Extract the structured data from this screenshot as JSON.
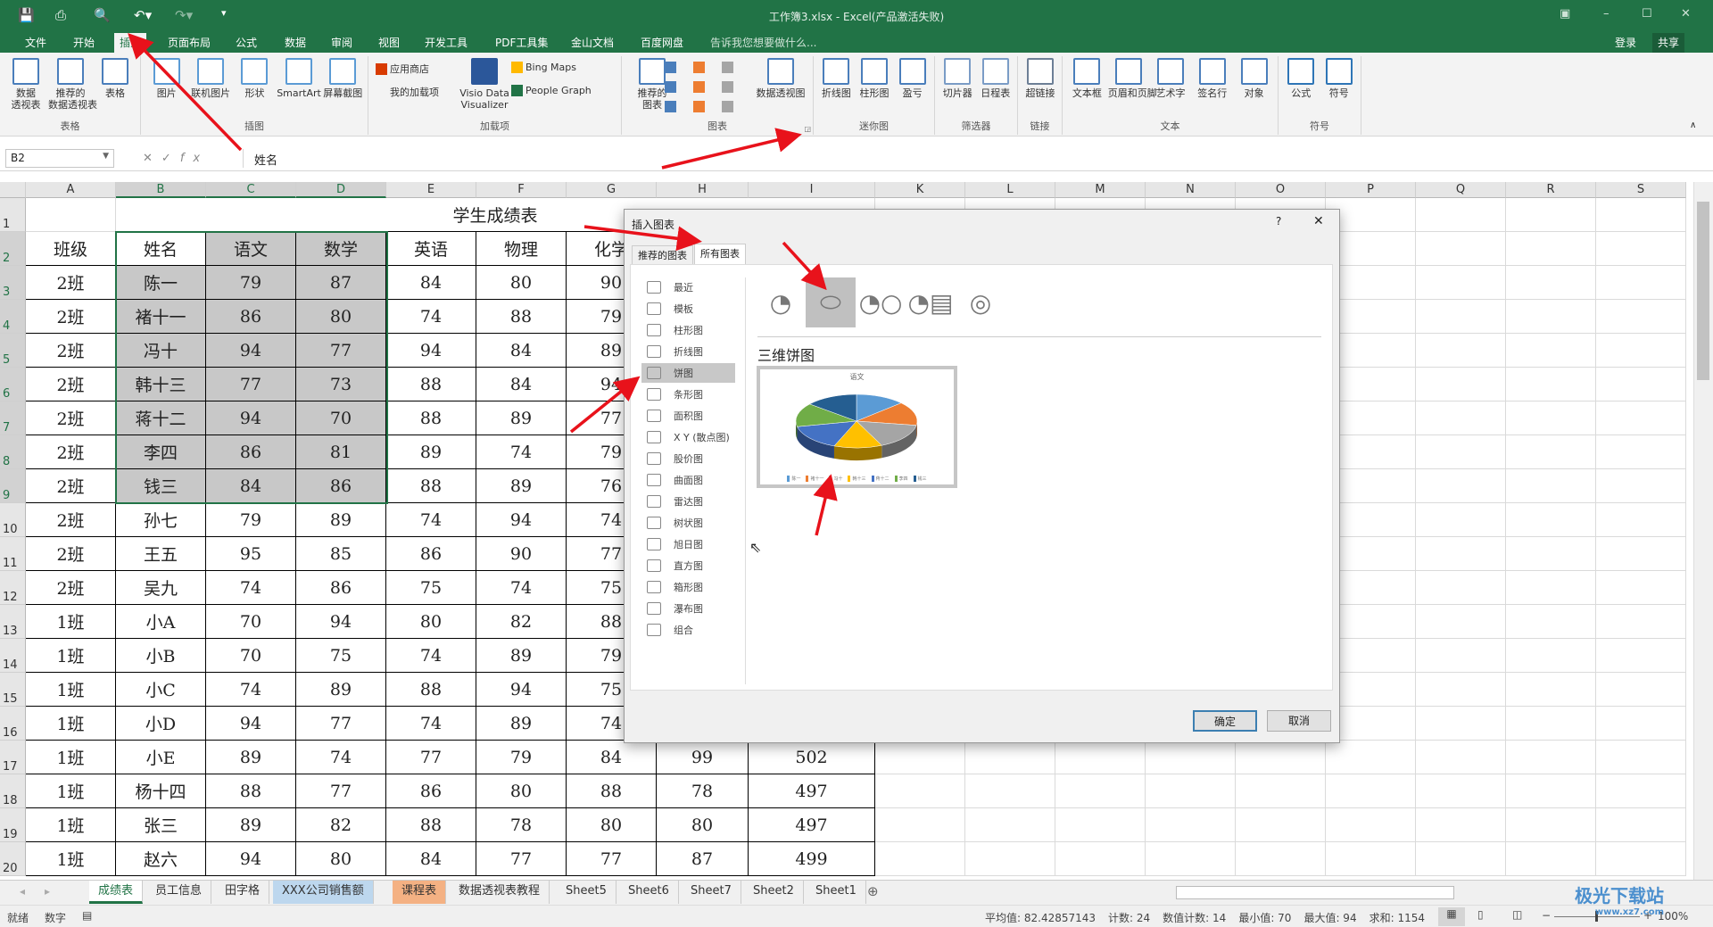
{
  "window": {
    "title": "工作簿3.xlsx - Excel(产品激活失败)",
    "controls": [
      "ribbon-display",
      "minimize",
      "maximize",
      "close"
    ]
  },
  "menu": {
    "tabs": [
      "文件",
      "开始",
      "插入",
      "页面布局",
      "公式",
      "数据",
      "审阅",
      "视图",
      "开发工具",
      "PDF工具集",
      "金山文档",
      "百度网盘"
    ],
    "active": "插入",
    "tell_me": "告诉我您想要做什么...",
    "login": "登录",
    "share": "共享"
  },
  "ribbon": {
    "groups": [
      {
        "label": "表格",
        "buttons": [
          "数据\n透视表",
          "推荐的\n数据透视表",
          "表格"
        ]
      },
      {
        "label": "插图",
        "buttons": [
          "图片",
          "联机图片",
          "形状",
          "SmartArt",
          "屏幕截图"
        ]
      },
      {
        "label": "加载项",
        "buttons": [
          "应用商店",
          "我的加载项",
          "Visio Data\nVisualizer",
          "Bing Maps",
          "People Graph"
        ]
      },
      {
        "label": "图表",
        "buttons": [
          "推荐的\n图表",
          "数据透视图"
        ]
      },
      {
        "label": "迷你图",
        "buttons": [
          "折线图",
          "柱形图",
          "盈亏"
        ]
      },
      {
        "label": "筛选器",
        "buttons": [
          "切片器",
          "日程表"
        ]
      },
      {
        "label": "链接",
        "buttons": [
          "超链接"
        ]
      },
      {
        "label": "文本",
        "buttons": [
          "文本框",
          "页眉和页脚",
          "艺术字",
          "签名行",
          "对象"
        ]
      },
      {
        "label": "符号",
        "buttons": [
          "公式",
          "符号"
        ]
      }
    ]
  },
  "formula_bar": {
    "name_box": "B2",
    "fx": "fx",
    "value": "姓名"
  },
  "sheet": {
    "columns": [
      "A",
      "B",
      "C",
      "D",
      "E",
      "F",
      "G",
      "H",
      "I",
      "K",
      "L",
      "M",
      "N",
      "O",
      "P",
      "Q",
      "R",
      "S"
    ],
    "title": "学生成绩表",
    "header": [
      "班级",
      "姓名",
      "语文",
      "数学",
      "英语",
      "物理",
      "化学",
      "",
      ""
    ],
    "rows": [
      [
        "2班",
        "陈一",
        "79",
        "87",
        "84",
        "80",
        "90",
        "",
        ""
      ],
      [
        "2班",
        "褚十一",
        "86",
        "80",
        "74",
        "88",
        "79",
        "",
        ""
      ],
      [
        "2班",
        "冯十",
        "94",
        "77",
        "94",
        "84",
        "89",
        "",
        ""
      ],
      [
        "2班",
        "韩十三",
        "77",
        "73",
        "88",
        "84",
        "94",
        "",
        ""
      ],
      [
        "2班",
        "蒋十二",
        "94",
        "70",
        "88",
        "89",
        "77",
        "",
        ""
      ],
      [
        "2班",
        "李四",
        "86",
        "81",
        "89",
        "74",
        "79",
        "",
        ""
      ],
      [
        "2班",
        "钱三",
        "84",
        "86",
        "88",
        "89",
        "76",
        "",
        ""
      ],
      [
        "2班",
        "孙七",
        "79",
        "89",
        "74",
        "94",
        "74",
        "",
        ""
      ],
      [
        "2班",
        "王五",
        "95",
        "85",
        "86",
        "90",
        "77",
        "",
        ""
      ],
      [
        "2班",
        "吴九",
        "74",
        "86",
        "75",
        "74",
        "75",
        "",
        ""
      ],
      [
        "1班",
        "小A",
        "70",
        "94",
        "80",
        "82",
        "88",
        "",
        ""
      ],
      [
        "1班",
        "小B",
        "70",
        "75",
        "74",
        "89",
        "79",
        "",
        ""
      ],
      [
        "1班",
        "小C",
        "74",
        "89",
        "88",
        "94",
        "75",
        "",
        ""
      ],
      [
        "1班",
        "小D",
        "94",
        "77",
        "74",
        "89",
        "74",
        "",
        ""
      ],
      [
        "1班",
        "小E",
        "89",
        "74",
        "77",
        "79",
        "84",
        "99",
        "502"
      ],
      [
        "1班",
        "杨十四",
        "88",
        "77",
        "86",
        "80",
        "88",
        "78",
        "497"
      ],
      [
        "1班",
        "张三",
        "89",
        "82",
        "88",
        "78",
        "80",
        "80",
        "497"
      ],
      [
        "1班",
        "赵六",
        "94",
        "80",
        "84",
        "77",
        "77",
        "87",
        "499"
      ]
    ]
  },
  "sheet_tabs": [
    {
      "label": "成绩表",
      "active": true
    },
    {
      "label": "员工信息"
    },
    {
      "label": "田字格"
    },
    {
      "label": "XXX公司销售额",
      "color": "#bdd7ee"
    },
    {
      "label": "课程表",
      "color": "#f4b183"
    },
    {
      "label": "数据透视表教程"
    },
    {
      "label": "Sheet5"
    },
    {
      "label": "Sheet6"
    },
    {
      "label": "Sheet7"
    },
    {
      "label": "Sheet2"
    },
    {
      "label": "Sheet1"
    }
  ],
  "status": {
    "ready": "就绪",
    "mode": "数字",
    "average": "平均值: 82.42857143",
    "count": "计数: 24",
    "numeric_count": "数值计数: 14",
    "min": "最小值: 70",
    "max": "最大值: 94",
    "sum": "求和: 1154",
    "zoom": "100%"
  },
  "dialog": {
    "title": "插入图表",
    "help": "?",
    "close": "✕",
    "tabs": [
      "推荐的图表",
      "所有图表"
    ],
    "active_tab": "所有图表",
    "categories": [
      "最近",
      "模板",
      "柱形图",
      "折线图",
      "饼图",
      "条形图",
      "面积图",
      "X Y (散点图)",
      "股价图",
      "曲面图",
      "雷达图",
      "树状图",
      "旭日图",
      "直方图",
      "箱形图",
      "瀑布图",
      "组合"
    ],
    "selected_category": "饼图",
    "subtypes": [
      "饼图",
      "三维饼图",
      "子母饼图",
      "复合条饼图",
      "圆环图"
    ],
    "selected_subtype": "三维饼图",
    "subtype_heading": "三维饼图",
    "preview": {
      "title": "语文",
      "legend": [
        "陈一",
        "褚十一",
        "冯十",
        "韩十三",
        "蒋十二",
        "李四",
        "钱三"
      ],
      "colors": [
        "#5b9bd5",
        "#ed7d31",
        "#a5a5a5",
        "#ffc000",
        "#4472c4",
        "#70ad47",
        "#255e91"
      ]
    },
    "ok": "确定",
    "cancel": "取消"
  },
  "watermark": {
    "text": "极光下载站",
    "url": "www.xz7.com"
  },
  "colors": {
    "excel_green": "#217346",
    "selection_fill": "#c8c8c8",
    "annotation_arrow": "#e8121b"
  }
}
